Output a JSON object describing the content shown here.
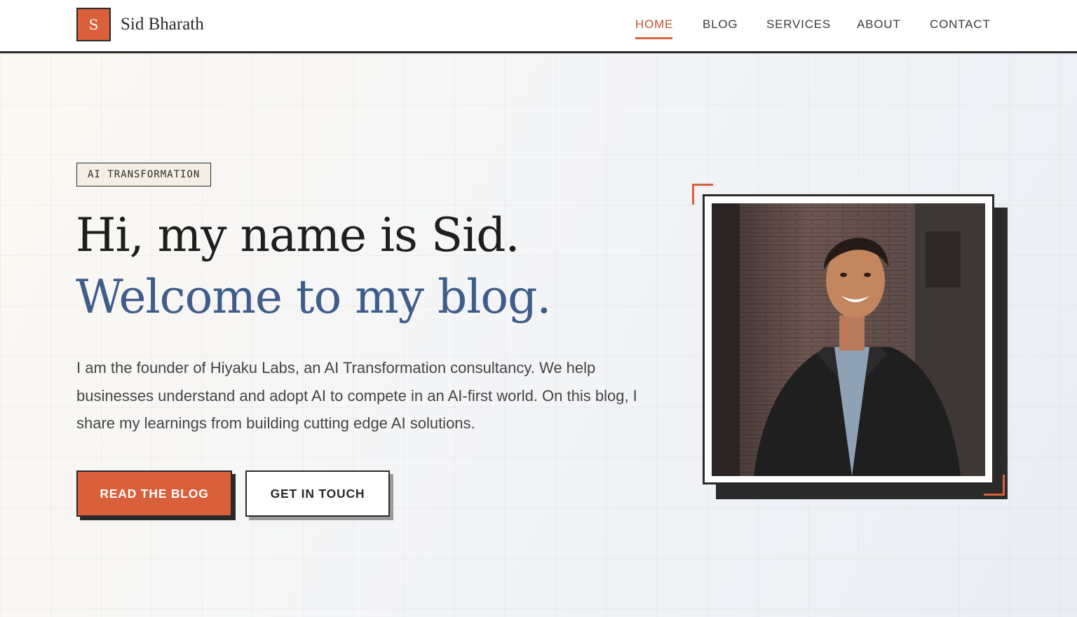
{
  "header": {
    "logo_letter": "S",
    "brand_name": "Sid Bharath",
    "nav": [
      {
        "label": "HOME",
        "active": true
      },
      {
        "label": "BLOG",
        "active": false
      },
      {
        "label": "SERVICES",
        "active": false
      },
      {
        "label": "ABOUT",
        "active": false
      },
      {
        "label": "CONTACT",
        "active": false
      }
    ]
  },
  "hero": {
    "tag": "AI TRANSFORMATION",
    "headline_line1": "Hi, my name is Sid.",
    "headline_line2": "Welcome to my blog.",
    "intro": "I am the founder of Hiyaku Labs, an AI Transformation consultancy. We help businesses understand and adopt AI to compete in an AI-first world. On this blog, I share my learnings from building cutting edge AI solutions.",
    "primary_button": "READ THE BLOG",
    "secondary_button": "GET IN TOUCH"
  },
  "colors": {
    "accent": "#d9603b",
    "headline_blue": "#3f5d8a",
    "ink": "#2a2a2a"
  }
}
